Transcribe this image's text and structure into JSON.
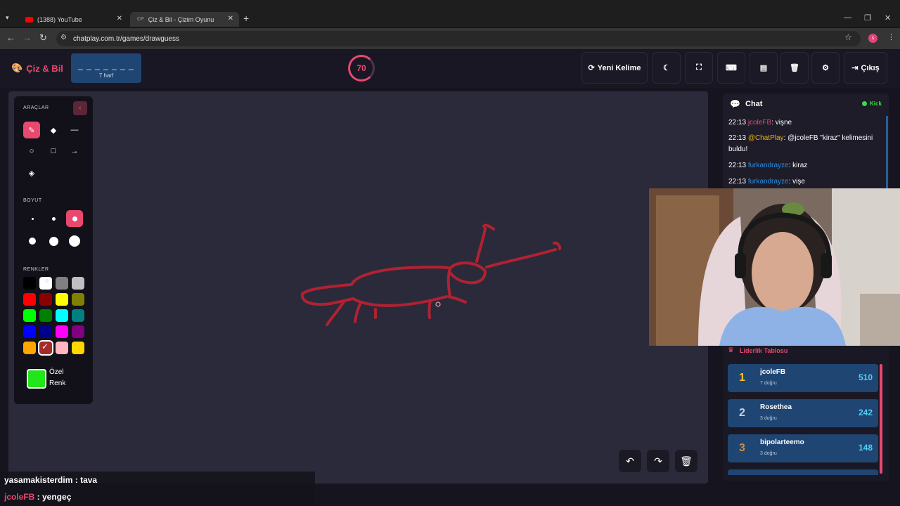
{
  "browser": {
    "tabs": [
      {
        "title": "(1388) YouTube"
      },
      {
        "title": "Çiz & Bil - Çizim Oyunu",
        "favicon": "CP"
      }
    ],
    "url": "chatplay.com.tr/games/drawguess",
    "profile_initial": "s"
  },
  "header": {
    "logo": "Çiz & Bil",
    "word_mask": "_ _ _ _ _ _ _",
    "word_count": "7 harf",
    "timer": "70",
    "new_word_label": "Yeni Kelime",
    "exit_label": "Çıkış"
  },
  "tools": {
    "title": "ARAÇLAR",
    "size_title": "BOYUT",
    "colors_title": "RENKLER",
    "custom_color_label": "Özel Renk",
    "custom_color": "#22e61a",
    "palette": [
      "#000000",
      "#ffffff",
      "#808080",
      "#c0c0c0",
      "#ff0000",
      "#8b0000",
      "#ffff00",
      "#808000",
      "#00ff00",
      "#008000",
      "#00ffff",
      "#008080",
      "#0000ff",
      "#00008b",
      "#ff00ff",
      "#800080",
      "#ffa500",
      "#a52a2a",
      "#ffb6c1",
      "#ffd700"
    ]
  },
  "chat": {
    "title": "Chat",
    "kick_label": "Kick",
    "messages": [
      {
        "time": "22:13",
        "user": "jcoleFB",
        "text": ": vişne"
      },
      {
        "time": "22:13",
        "user": "@ChatPlay",
        "text": ": @jcoleFB \"kiraz\" kelimesini buldu!"
      },
      {
        "time": "22:13",
        "user": "furkandrayze",
        "text": ": kiraz"
      },
      {
        "time": "22:13",
        "user": "furkandrayze",
        "text": ": vişe"
      }
    ]
  },
  "leaderboard": {
    "title": "Liderlik Tablosu",
    "rows": [
      {
        "rank": "1",
        "name": "jcoleFB",
        "sub": "7 doğru",
        "score": "510"
      },
      {
        "rank": "2",
        "name": "Rosethea",
        "sub": "3 doğru",
        "score": "242"
      },
      {
        "rank": "3",
        "name": "bipolarteemo",
        "sub": "3 doğru",
        "score": "148"
      }
    ]
  },
  "overlay": {
    "lines": [
      {
        "user": "yasamakisterdim",
        "text": " : tava"
      },
      {
        "user": "jcoleFB",
        "text": " : yengeç"
      }
    ]
  },
  "colors": {
    "accent": "#e8496f",
    "stroke": "#b02232",
    "panel_blue": "#1f4573"
  }
}
